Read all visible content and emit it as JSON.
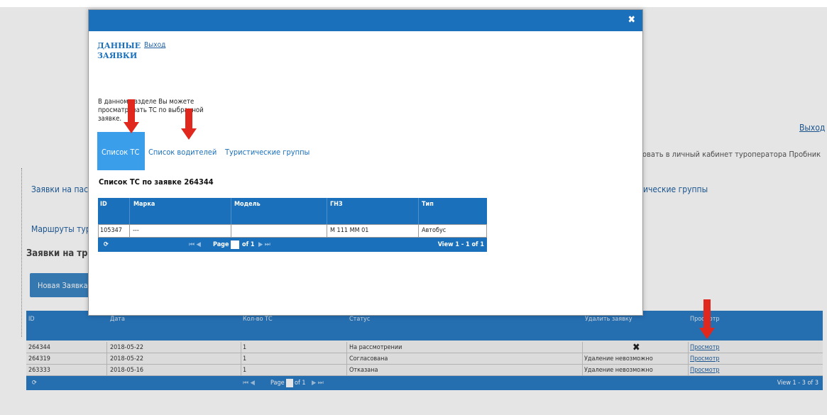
{
  "background": {
    "exit_label": "Выход",
    "welcome_text": "овать в личный кабинет туроператора Пробник",
    "nav_link_1": "Заявки на пас",
    "nav_link_2": "Маршруты тур",
    "nav_link_3": "ические группы",
    "section_heading": "Заявки на тра",
    "new_request_button": "Новая Заявка",
    "table": {
      "columns": [
        "ID",
        "Дата",
        "Кол-во ТС",
        "Статус",
        "Удалить заявку",
        "Просмотр"
      ],
      "rows": [
        {
          "id": "264344",
          "date": "2018-05-22",
          "count": "1",
          "status": "На рассмотрении",
          "delete": "✖",
          "view": "Просмотр"
        },
        {
          "id": "264319",
          "date": "2018-05-22",
          "count": "1",
          "status": "Согласована",
          "delete": "Удаление невозможно",
          "view": "Просмотр"
        },
        {
          "id": "263333",
          "date": "2018-05-16",
          "count": "1",
          "status": "Отказана",
          "delete": "Удаление невозможно",
          "view": "Просмотр"
        }
      ],
      "pager": {
        "refresh_icon": "⟳",
        "first_prev": "⏮ ◀",
        "page_label": "Page",
        "page_value": "1",
        "of_label": "of 1",
        "next_last": "▶ ⏭",
        "view_text": "View 1 - 3 of 3"
      }
    }
  },
  "modal": {
    "close_icon": "✖",
    "title": "ДАННЫЕ ЗАЯВКИ",
    "exit_label": "Выход",
    "description": "В данном разделе Вы можете просматривать ТС по выбранной заявке.",
    "tabs": [
      "Список ТС",
      "Список водителей",
      "Туристические группы"
    ],
    "list_title": "Список ТС по заявке 264344",
    "table": {
      "columns": [
        "ID",
        "Марка",
        "Модель",
        "ГНЗ",
        "Тип"
      ],
      "rows": [
        {
          "id": "105347",
          "brand": "---",
          "model": "",
          "plate": "М 111 ММ 01",
          "type": "Автобус"
        }
      ],
      "pager": {
        "refresh_icon": "⟳",
        "first_prev": "⏮ ◀",
        "page_label": "Page",
        "page_value": "1",
        "of_label": "of 1",
        "next_last": "▶ ⏭",
        "view_text": "View 1 - 1 of 1"
      }
    }
  },
  "colors": {
    "accent": "#1a70bb",
    "active_tab": "#3b9eea",
    "arrow": "#e0281e"
  }
}
